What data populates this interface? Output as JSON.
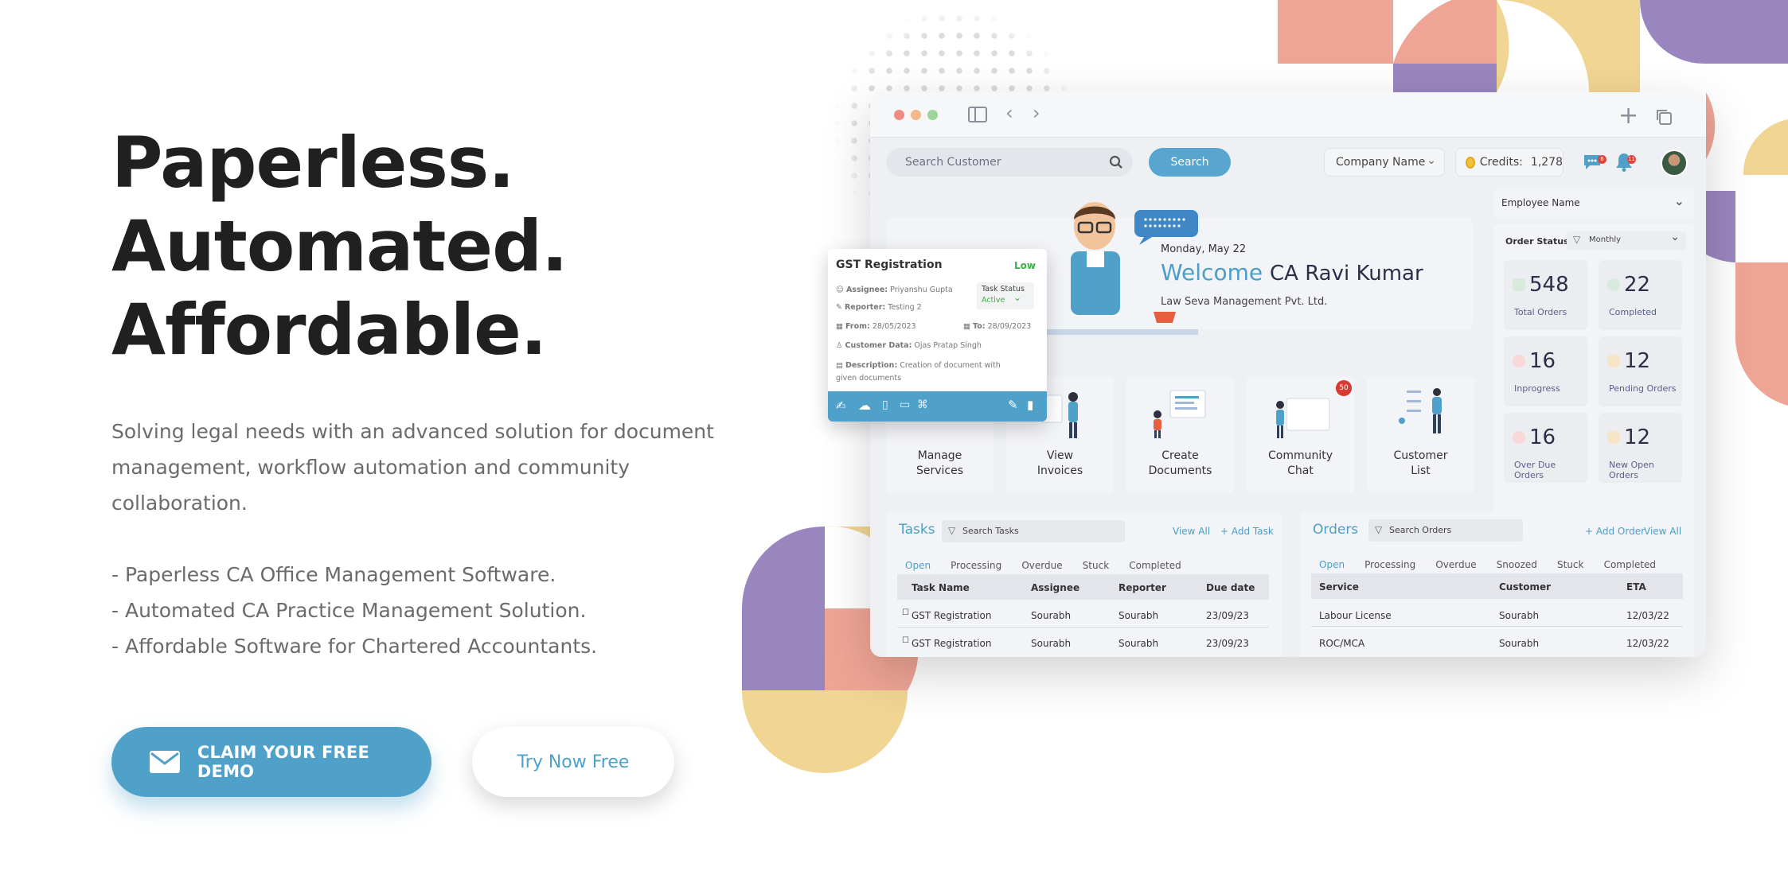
{
  "hero": {
    "headline": [
      "Paperless.",
      "Automated.",
      "Affordable."
    ],
    "lead": "Solving legal needs with an advanced solution for document management, workflow automation and community collaboration.",
    "bullets": [
      "- Paperless CA Office Management Software.",
      "- Automated CA Practice Management Solution.",
      "- Affordable Software for Chartered Accountants."
    ],
    "cta_primary": "CLAIM YOUR FREE DEMO",
    "cta_secondary": "Try Now Free"
  },
  "app": {
    "search_placeholder": "Search Customer",
    "search_button": "Search",
    "company_select": "Company Name",
    "credits_label": "Credits:",
    "credits_value": "1,278",
    "chat_badge": "6",
    "bell_badge": "11",
    "employee_select": "Employee Name",
    "welcome": {
      "date": "Monday, May 22",
      "welcome_word": "Welcome",
      "name": "CA Ravi Kumar",
      "company": "Law Seva Management Pvt. Ltd."
    },
    "order_status": {
      "label": "Order Status",
      "period": "Monthly",
      "stats": [
        {
          "value": "548",
          "label": "Total Orders"
        },
        {
          "value": "22",
          "label": "Completed"
        },
        {
          "value": "16",
          "label": "Inprogress"
        },
        {
          "value": "12",
          "label": "Pending Orders"
        },
        {
          "value": "16",
          "label": "Over Due Orders"
        },
        {
          "value": "12",
          "label": "New Open Orders"
        }
      ]
    },
    "tiles": [
      {
        "line1": "Manage",
        "line2": "Services"
      },
      {
        "line1": "View",
        "line2": "Invoices"
      },
      {
        "line1": "Create",
        "line2": "Documents"
      },
      {
        "line1": "Community",
        "line2": "Chat",
        "badge": "50"
      },
      {
        "line1": "Customer",
        "line2": "List"
      }
    ],
    "tasks": {
      "title": "Tasks",
      "search": "Search Tasks",
      "view_all": "View All",
      "add": "+ Add Task",
      "tabs": [
        "Open",
        "Processing",
        "Overdue",
        "Stuck",
        "Completed"
      ],
      "columns": [
        "Task Name",
        "Assignee",
        "Reporter",
        "Due date"
      ],
      "rows": [
        [
          "GST Registration",
          "Sourabh",
          "Sourabh",
          "23/09/23"
        ],
        [
          "GST Registration",
          "Sourabh",
          "Sourabh",
          "23/09/23"
        ]
      ]
    },
    "orders": {
      "title": "Orders",
      "search": "Search Orders",
      "add": "+ Add Order",
      "view_all": "View All",
      "tabs": [
        "Open",
        "Processing",
        "Overdue",
        "Snoozed",
        "Stuck",
        "Completed"
      ],
      "columns": [
        "Service",
        "Customer",
        "ETA"
      ],
      "rows": [
        [
          "Labour License",
          "Sourabh",
          "12/03/22"
        ],
        [
          "ROC/MCA",
          "Sourabh",
          "12/03/22"
        ]
      ]
    },
    "task_card": {
      "title": "GST Registration",
      "priority": "Low",
      "assignee_label": "Assignee:",
      "assignee": "Priyanshu Gupta",
      "reporter_label": "Reporter:",
      "reporter": "Testing 2",
      "status_label": "Task Status",
      "status": "Active",
      "from_label": "From:",
      "from": "28/05/2023",
      "to_label": "To:",
      "to": "28/09/2023",
      "customer_label": "Customer Data:",
      "customer": "Ojas Pratap Singh",
      "desc_label": "Description:",
      "desc": "Creation of document with given documents"
    }
  },
  "colors": {
    "accent": "#4fa1c9",
    "deco_purple": "#9a86bf",
    "deco_salmon": "#efa596",
    "deco_yellow": "#f1d592"
  }
}
